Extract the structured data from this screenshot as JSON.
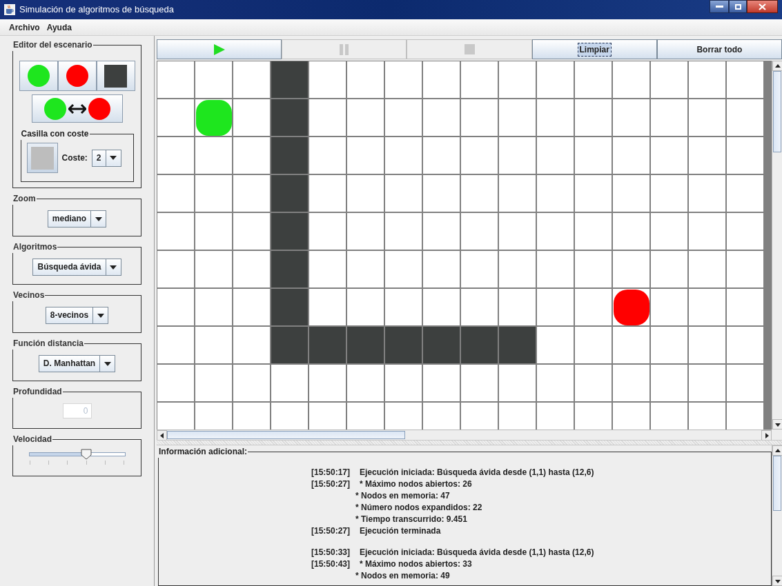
{
  "window": {
    "title": "Simulación de algoritmos de búsqueda"
  },
  "menu": [
    "Archivo",
    "Ayuda"
  ],
  "editor": {
    "title": "Editor del escenario",
    "tools": [
      {
        "kind": "start"
      },
      {
        "kind": "goal"
      },
      {
        "kind": "wall"
      }
    ],
    "swap": {
      "kind": "swap"
    },
    "cost_cell": {
      "title": "Casilla con coste",
      "label": "Coste:",
      "value": "2"
    }
  },
  "settings": [
    {
      "title": "Zoom",
      "value": "mediano"
    },
    {
      "title": "Algoritmos",
      "value": "Búsqueda ávida"
    },
    {
      "title": "Vecinos",
      "value": "8-vecinos"
    },
    {
      "title": "Función distancia",
      "value": "D. Manhattan"
    }
  ],
  "depth": {
    "title": "Profundidad",
    "value": "0",
    "disabled": true
  },
  "speed": {
    "title": "Velocidad",
    "level": 0.6
  },
  "toolbar": [
    {
      "kind": "play",
      "disabled": false
    },
    {
      "kind": "pause",
      "disabled": true
    },
    {
      "kind": "stop",
      "disabled": true
    },
    {
      "kind": "text",
      "label": "Limpiar",
      "focused": true
    },
    {
      "kind": "text",
      "label": "Borrar todo",
      "focused": false
    }
  ],
  "grid": {
    "rows": [
      [
        {
          "kind": "empty"
        },
        {
          "kind": "empty"
        },
        {
          "kind": "empty"
        },
        {
          "kind": "wall"
        },
        {
          "kind": "empty"
        },
        {
          "kind": "empty"
        },
        {
          "kind": "empty"
        },
        {
          "kind": "empty"
        },
        {
          "kind": "empty"
        },
        {
          "kind": "empty"
        },
        {
          "kind": "empty"
        },
        {
          "kind": "empty"
        },
        {
          "kind": "empty"
        },
        {
          "kind": "empty"
        },
        {
          "kind": "empty"
        },
        {
          "kind": "empty"
        }
      ],
      [
        {
          "kind": "empty"
        },
        {
          "kind": "start"
        },
        {
          "kind": "empty"
        },
        {
          "kind": "wall"
        },
        {
          "kind": "empty"
        },
        {
          "kind": "empty"
        },
        {
          "kind": "empty"
        },
        {
          "kind": "empty"
        },
        {
          "kind": "empty"
        },
        {
          "kind": "empty"
        },
        {
          "kind": "empty"
        },
        {
          "kind": "empty"
        },
        {
          "kind": "empty"
        },
        {
          "kind": "empty"
        },
        {
          "kind": "empty"
        },
        {
          "kind": "empty"
        }
      ],
      [
        {
          "kind": "empty"
        },
        {
          "kind": "empty"
        },
        {
          "kind": "empty"
        },
        {
          "kind": "wall"
        },
        {
          "kind": "empty"
        },
        {
          "kind": "empty"
        },
        {
          "kind": "empty"
        },
        {
          "kind": "empty"
        },
        {
          "kind": "empty"
        },
        {
          "kind": "empty"
        },
        {
          "kind": "empty"
        },
        {
          "kind": "empty"
        },
        {
          "kind": "empty"
        },
        {
          "kind": "empty"
        },
        {
          "kind": "empty"
        },
        {
          "kind": "empty"
        }
      ],
      [
        {
          "kind": "empty"
        },
        {
          "kind": "empty"
        },
        {
          "kind": "empty"
        },
        {
          "kind": "wall"
        },
        {
          "kind": "empty"
        },
        {
          "kind": "empty"
        },
        {
          "kind": "empty"
        },
        {
          "kind": "empty"
        },
        {
          "kind": "empty"
        },
        {
          "kind": "empty"
        },
        {
          "kind": "empty"
        },
        {
          "kind": "empty"
        },
        {
          "kind": "empty"
        },
        {
          "kind": "empty"
        },
        {
          "kind": "empty"
        },
        {
          "kind": "empty"
        }
      ],
      [
        {
          "kind": "empty"
        },
        {
          "kind": "empty"
        },
        {
          "kind": "empty"
        },
        {
          "kind": "wall"
        },
        {
          "kind": "empty"
        },
        {
          "kind": "empty"
        },
        {
          "kind": "empty"
        },
        {
          "kind": "empty"
        },
        {
          "kind": "empty"
        },
        {
          "kind": "empty"
        },
        {
          "kind": "empty"
        },
        {
          "kind": "empty"
        },
        {
          "kind": "empty"
        },
        {
          "kind": "empty"
        },
        {
          "kind": "empty"
        },
        {
          "kind": "empty"
        }
      ],
      [
        {
          "kind": "empty"
        },
        {
          "kind": "empty"
        },
        {
          "kind": "empty"
        },
        {
          "kind": "wall"
        },
        {
          "kind": "empty"
        },
        {
          "kind": "empty"
        },
        {
          "kind": "empty"
        },
        {
          "kind": "empty"
        },
        {
          "kind": "empty"
        },
        {
          "kind": "empty"
        },
        {
          "kind": "empty"
        },
        {
          "kind": "empty"
        },
        {
          "kind": "empty"
        },
        {
          "kind": "empty"
        },
        {
          "kind": "empty"
        },
        {
          "kind": "empty"
        }
      ],
      [
        {
          "kind": "empty"
        },
        {
          "kind": "empty"
        },
        {
          "kind": "empty"
        },
        {
          "kind": "wall"
        },
        {
          "kind": "empty"
        },
        {
          "kind": "empty"
        },
        {
          "kind": "empty"
        },
        {
          "kind": "empty"
        },
        {
          "kind": "empty"
        },
        {
          "kind": "empty"
        },
        {
          "kind": "empty"
        },
        {
          "kind": "empty"
        },
        {
          "kind": "goal"
        },
        {
          "kind": "empty"
        },
        {
          "kind": "empty"
        },
        {
          "kind": "empty"
        }
      ],
      [
        {
          "kind": "empty"
        },
        {
          "kind": "empty"
        },
        {
          "kind": "empty"
        },
        {
          "kind": "wall"
        },
        {
          "kind": "wall"
        },
        {
          "kind": "wall"
        },
        {
          "kind": "wall"
        },
        {
          "kind": "wall"
        },
        {
          "kind": "wall"
        },
        {
          "kind": "wall"
        },
        {
          "kind": "empty"
        },
        {
          "kind": "empty"
        },
        {
          "kind": "empty"
        },
        {
          "kind": "empty"
        },
        {
          "kind": "empty"
        },
        {
          "kind": "empty"
        }
      ],
      [
        {
          "kind": "empty"
        },
        {
          "kind": "empty"
        },
        {
          "kind": "empty"
        },
        {
          "kind": "empty"
        },
        {
          "kind": "empty"
        },
        {
          "kind": "empty"
        },
        {
          "kind": "empty"
        },
        {
          "kind": "empty"
        },
        {
          "kind": "empty"
        },
        {
          "kind": "empty"
        },
        {
          "kind": "empty"
        },
        {
          "kind": "empty"
        },
        {
          "kind": "empty"
        },
        {
          "kind": "empty"
        },
        {
          "kind": "empty"
        },
        {
          "kind": "empty"
        }
      ],
      [
        {
          "kind": "empty"
        },
        {
          "kind": "empty"
        },
        {
          "kind": "empty"
        },
        {
          "kind": "empty"
        },
        {
          "kind": "empty"
        },
        {
          "kind": "empty"
        },
        {
          "kind": "empty"
        },
        {
          "kind": "empty"
        },
        {
          "kind": "empty"
        },
        {
          "kind": "empty"
        },
        {
          "kind": "empty"
        },
        {
          "kind": "empty"
        },
        {
          "kind": "empty"
        },
        {
          "kind": "empty"
        },
        {
          "kind": "empty"
        },
        {
          "kind": "empty"
        }
      ]
    ]
  },
  "info": {
    "title": "Información adicional:",
    "lines": [
      {
        "kind": "entry",
        "time": "[15:50:17]",
        "text": "Ejecución iniciada: Búsqueda ávida desde (1,1) hasta (12,6)"
      },
      {
        "kind": "entry",
        "time": "[15:50:27]",
        "text": "* Máximo nodos abiertos:  26"
      },
      {
        "kind": "detail",
        "text": "* Nodos en memoria:  47"
      },
      {
        "kind": "detail",
        "text": "* Número nodos expandidos:  22"
      },
      {
        "kind": "detail",
        "text": "* Tiempo transcurrido:  9.451"
      },
      {
        "kind": "entry",
        "time": "[15:50:27]",
        "text": "Ejecución terminada"
      },
      {
        "kind": "gap"
      },
      {
        "kind": "entry",
        "time": "[15:50:33]",
        "text": "Ejecución iniciada: Búsqueda ávida desde (1,1) hasta (12,6)"
      },
      {
        "kind": "entry",
        "time": "[15:50:43]",
        "text": "* Máximo nodos abiertos:  33"
      },
      {
        "kind": "detail",
        "text": "* Nodos en memoria:  49"
      }
    ]
  }
}
